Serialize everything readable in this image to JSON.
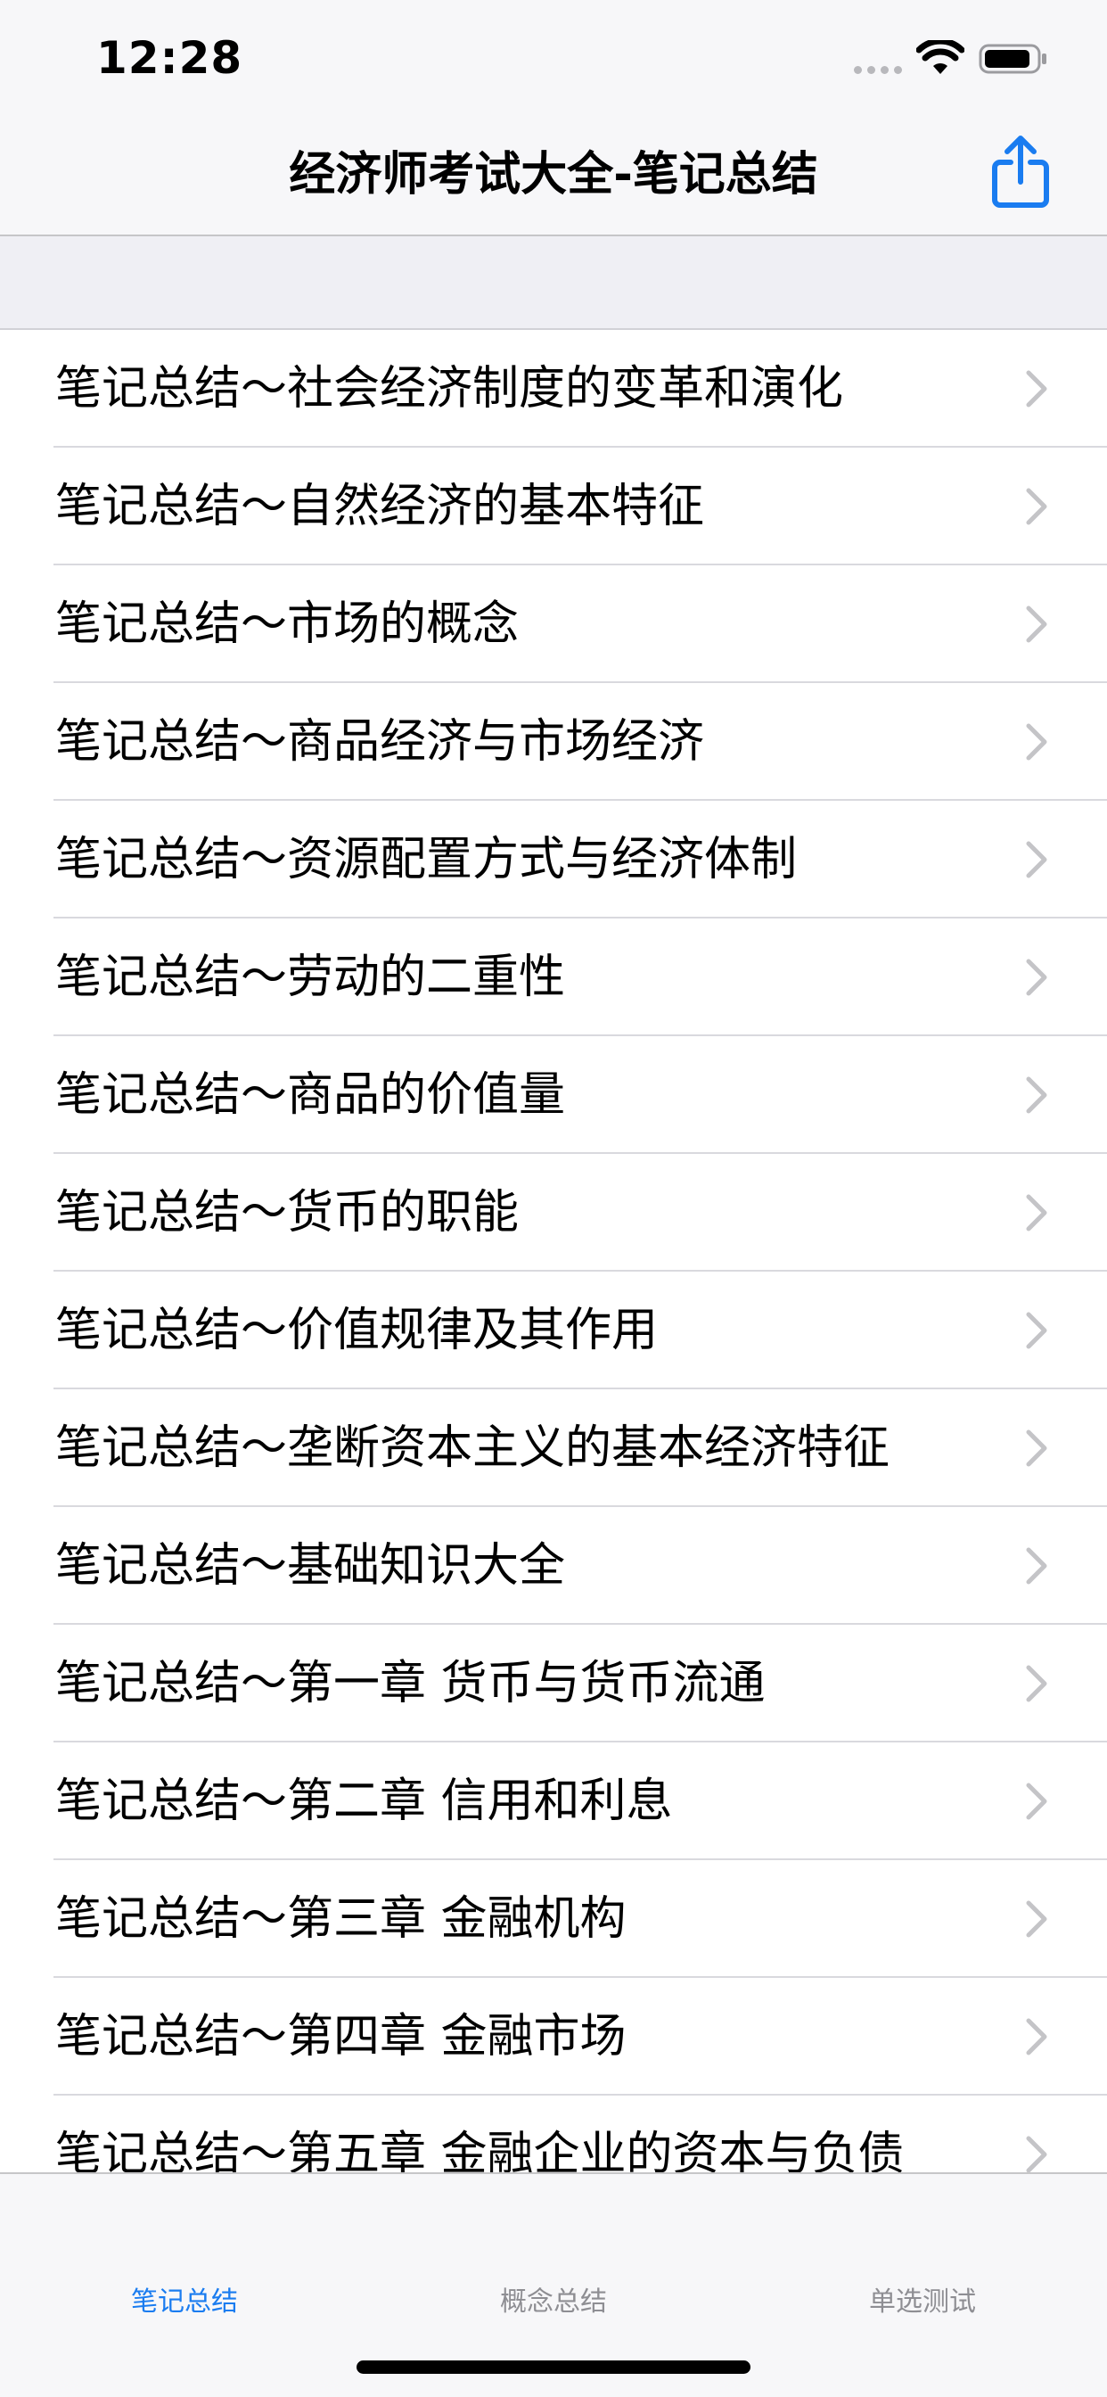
{
  "status_bar": {
    "time": "12:28"
  },
  "nav": {
    "title": "经济师考试大全-笔记总结",
    "share_icon": "share-icon",
    "accent_color": "#1a7cf0"
  },
  "list": {
    "items": [
      {
        "label": "笔记总结～社会经济制度的变革和演化"
      },
      {
        "label": "笔记总结～自然经济的基本特征"
      },
      {
        "label": "笔记总结～市场的概念"
      },
      {
        "label": "笔记总结～商品经济与市场经济"
      },
      {
        "label": "笔记总结～资源配置方式与经济体制"
      },
      {
        "label": "笔记总结～劳动的二重性"
      },
      {
        "label": "笔记总结～商品的价值量"
      },
      {
        "label": "笔记总结～货币的职能"
      },
      {
        "label": "笔记总结～价值规律及其作用"
      },
      {
        "label": "笔记总结～垄断资本主义的基本经济特征"
      },
      {
        "label": "笔记总结～基础知识大全"
      },
      {
        "label": "笔记总结～第一章 货币与货币流通"
      },
      {
        "label": "笔记总结～第二章 信用和利息"
      },
      {
        "label": "笔记总结～第三章 金融机构"
      },
      {
        "label": "笔记总结～第四章 金融市场"
      },
      {
        "label": "笔记总结～第五章 金融企业的资本与负债"
      }
    ]
  },
  "tab_bar": {
    "tabs": [
      {
        "label": "笔记总结",
        "active": true
      },
      {
        "label": "概念总结",
        "active": false
      },
      {
        "label": "单选测试",
        "active": false
      }
    ]
  }
}
